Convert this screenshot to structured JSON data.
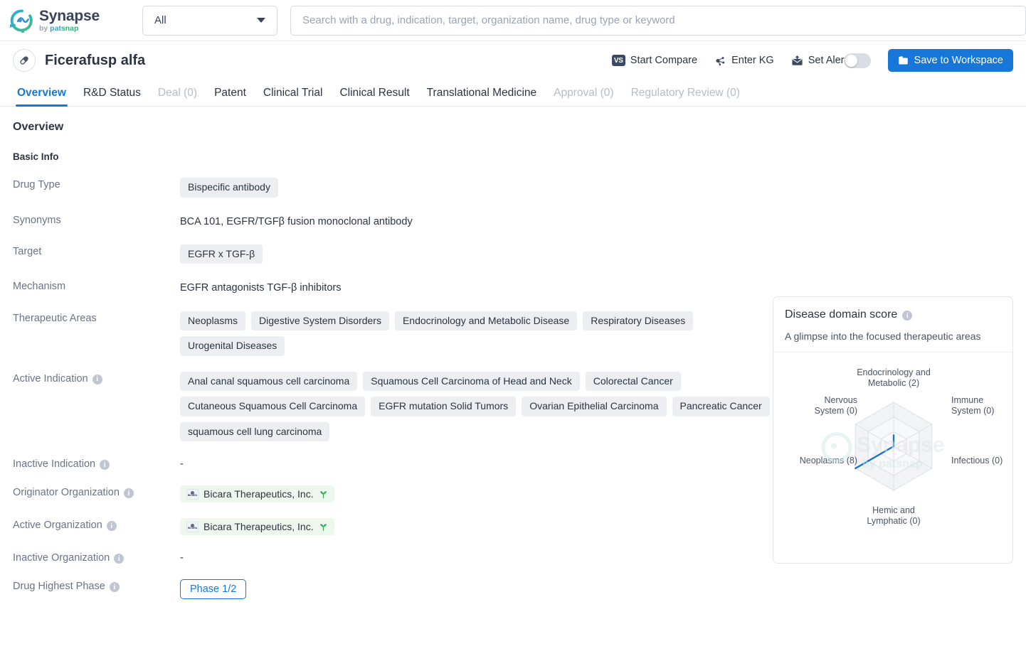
{
  "brand": {
    "name": "Synapse",
    "by": "by ",
    "p1": "pat",
    "p2": "snap"
  },
  "search": {
    "scope_value": "All",
    "placeholder": "Search with a drug, indication, target, organization name, drug type or keyword",
    "value": ""
  },
  "drug_header": {
    "title": "Ficerafusp alfa",
    "actions": {
      "start_compare": "Start Compare",
      "vs_label": "VS",
      "enter_kg": "Enter KG",
      "set_alert": "Set Alert",
      "save_to_workspace": "Save to Workspace"
    }
  },
  "tabs": [
    {
      "label": "Overview",
      "state": "active"
    },
    {
      "label": "R&D Status",
      "state": "normal"
    },
    {
      "label": "Deal (0)",
      "state": "disabled"
    },
    {
      "label": "Patent",
      "state": "normal"
    },
    {
      "label": "Clinical Trial",
      "state": "normal"
    },
    {
      "label": "Clinical Result",
      "state": "normal"
    },
    {
      "label": "Translational Medicine",
      "state": "normal"
    },
    {
      "label": "Approval (0)",
      "state": "disabled"
    },
    {
      "label": "Regulatory Review (0)",
      "state": "disabled"
    }
  ],
  "overview": {
    "section_title": "Overview",
    "basic_info_title": "Basic Info",
    "labels": {
      "drug_type": "Drug Type",
      "synonyms": "Synonyms",
      "target": "Target",
      "mechanism": "Mechanism",
      "therapeutic_areas": "Therapeutic Areas",
      "active_indication": "Active Indication",
      "inactive_indication": "Inactive Indication",
      "originator_organization": "Originator Organization",
      "active_organization": "Active Organization",
      "inactive_organization": "Inactive Organization",
      "drug_highest_phase": "Drug Highest Phase"
    },
    "drug_type": [
      "Bispecific antibody"
    ],
    "synonyms": "BCA 101,  EGFR/TGFβ fusion monoclonal antibody",
    "target": [
      "EGFR x TGF-β"
    ],
    "mechanism": "EGFR antagonists  TGF-β inhibitors",
    "therapeutic_areas": [
      "Neoplasms",
      "Digestive System Disorders",
      "Endocrinology and Metabolic Disease",
      "Respiratory Diseases",
      "Urogenital Diseases"
    ],
    "active_indication": [
      "Anal canal squamous cell carcinoma",
      "Squamous Cell Carcinoma of Head and Neck",
      "Colorectal Cancer",
      "Cutaneous Squamous Cell Carcinoma",
      "EGFR mutation Solid Tumors",
      "Ovarian Epithelial Carcinoma",
      "Pancreatic Cancer",
      "squamous cell lung carcinoma"
    ],
    "inactive_indication": "-",
    "originator_organization": [
      "Bicara Therapeutics, Inc."
    ],
    "active_organization": [
      "Bicara Therapeutics, Inc."
    ],
    "inactive_organization": "-",
    "drug_highest_phase": "Phase 1/2",
    "org_logo_text": "BICARA"
  },
  "score_card": {
    "title": "Disease domain score",
    "subtitle": "A glimpse into the focused therapeutic areas",
    "watermark_top": "Synapse",
    "watermark_bottom": "by patsnap"
  },
  "chart_data": {
    "type": "radar",
    "title": "Disease domain score",
    "subtitle": "A glimpse into the focused therapeutic areas",
    "categories": [
      "Endocrinology and Metabolic",
      "Immune System",
      "Infectious",
      "Hemic and Lymphatic",
      "Neoplasms",
      "Nervous System"
    ],
    "tick_labels": [
      "Endocrinology and Metabolic (2)",
      "Immune System (0)",
      "Infectious (0)",
      "Hemic and Lymphatic (0)",
      "Neoplasms (8)",
      "Nervous System (0)"
    ],
    "values": [
      2,
      0,
      0,
      0,
      8,
      0
    ],
    "max": 8,
    "rings": 3,
    "series": [
      {
        "name": "Disease domain score",
        "values": [
          2,
          0,
          0,
          0,
          8,
          0
        ],
        "color": "#1a73c8"
      }
    ],
    "grid": true,
    "legend": false,
    "colors": {
      "line": "#1a73c8",
      "grid": "#dcdfe4",
      "fill": "#f2f3f5"
    }
  },
  "colors": {
    "accent": "#1677d8",
    "tag_bg": "#eceef2",
    "org_tag_bg": "#edf7ed",
    "muted": "#6a7387"
  }
}
